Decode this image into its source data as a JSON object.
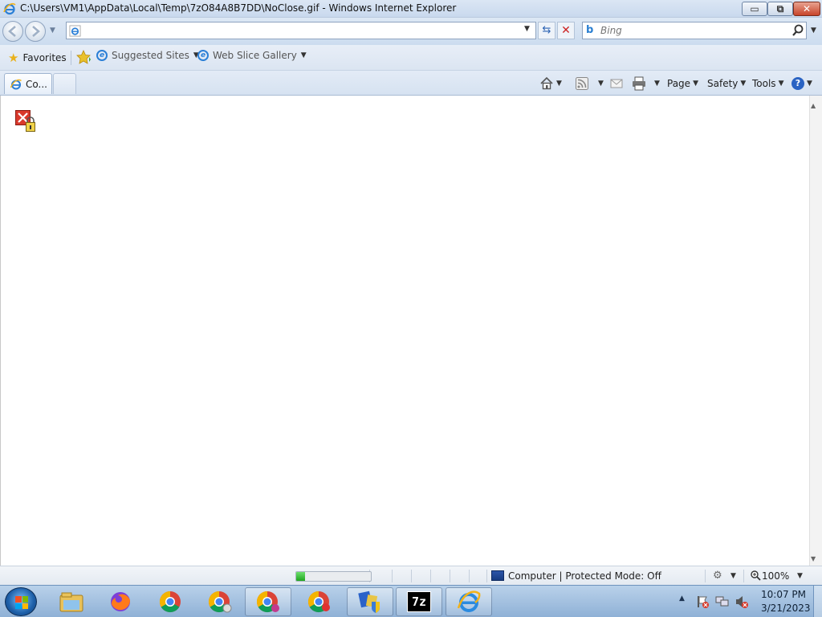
{
  "window": {
    "title": "C:\\Users\\VM1\\AppData\\Local\\Temp\\7zO84A8B7DD\\NoClose.gif - Windows Internet Explorer",
    "minimize_glyph": "▭",
    "maximize_glyph": "⧉",
    "close_glyph": "✕"
  },
  "navigation": {
    "address_value": "",
    "search_placeholder": "Bing",
    "refresh_glyph": "⇆",
    "stop_glyph": "✕"
  },
  "favorites_bar": {
    "favorites_label": "Favorites",
    "suggested_sites_label": "Suggested Sites",
    "web_slice_label": "Web Slice Gallery"
  },
  "tabs": [
    {
      "label": "Co..."
    }
  ],
  "command_bar": {
    "page_label": "Page",
    "safety_label": "Safety",
    "tools_label": "Tools",
    "help_label": "?"
  },
  "status_bar": {
    "zone_text": "Computer | Protected Mode: Off",
    "zoom_text": "100%",
    "progress": 0.12
  },
  "taskbar": {
    "time": "10:07 PM",
    "date": "3/21/2023",
    "apps": [
      {
        "icon": "explorer-icon"
      },
      {
        "icon": "firefox-icon"
      },
      {
        "icon": "chrome-icon"
      },
      {
        "icon": "chrome-profile-icon"
      },
      {
        "icon": "chrome-canary-icon"
      },
      {
        "icon": "chrome-dev-icon"
      },
      {
        "icon": "installer-shield-icon"
      },
      {
        "icon": "7zip-icon",
        "label": "7z"
      },
      {
        "icon": "internet-explorer-icon"
      }
    ]
  },
  "colors": {
    "accent": "#2a63c3",
    "close_button": "#c8442a",
    "progress_fill": "#1fa51f"
  }
}
